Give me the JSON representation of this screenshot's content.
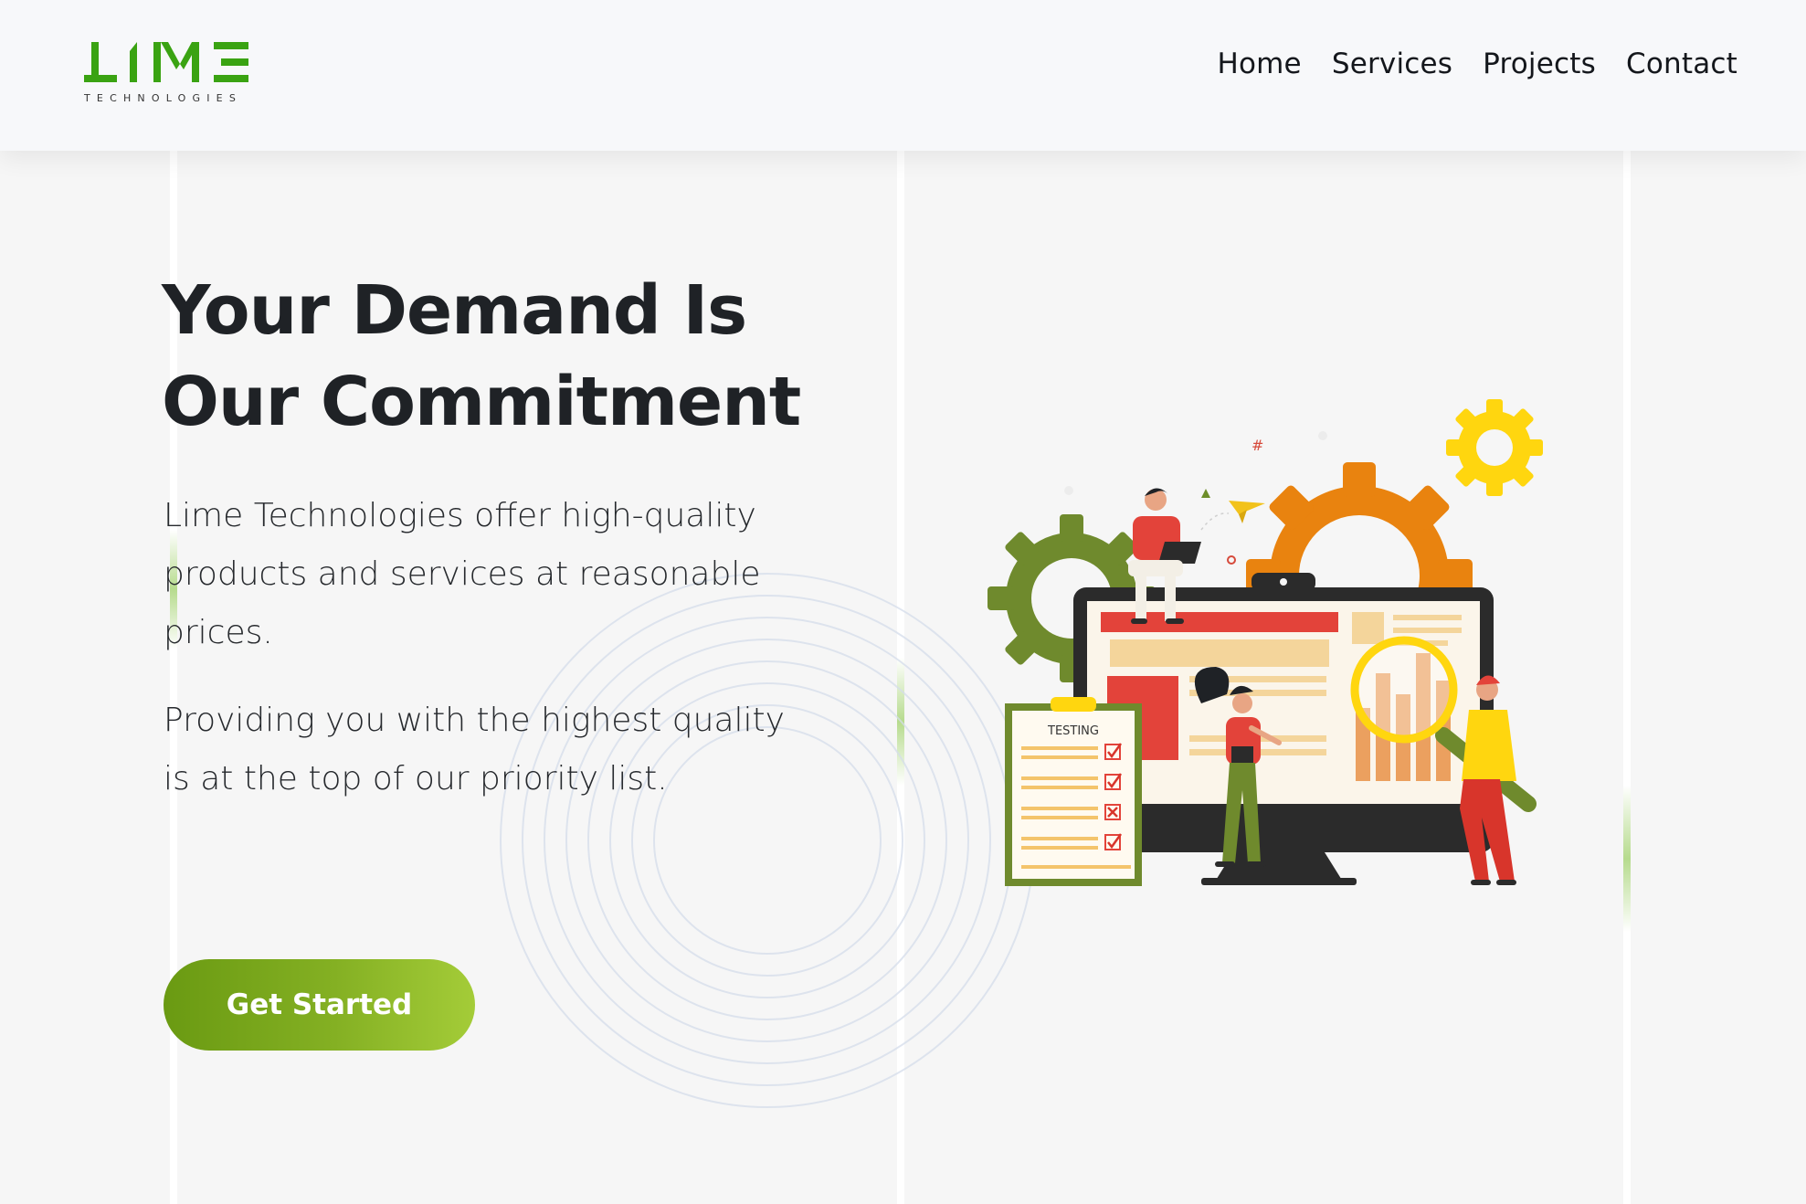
{
  "brand": {
    "name": "LIME",
    "tagline": "TECHNOLOGIES",
    "color": "#3aa312"
  },
  "nav": {
    "items": [
      {
        "label": "Home"
      },
      {
        "label": "Services"
      },
      {
        "label": "Projects"
      },
      {
        "label": "Contact"
      }
    ]
  },
  "hero": {
    "title_line1": "Your Demand Is",
    "title_line2": "Our Commitment",
    "paragraph1": "Lime Technologies offer high-quality products and services at reasonable prices.",
    "paragraph2": "Providing you with the highest quality is at the top of our priority list.",
    "cta_label": "Get Started",
    "cta_gradient": [
      "#6a9a12",
      "#a4cc38"
    ]
  },
  "illustration": {
    "clipboard_label": "TESTING",
    "icons": [
      "gear-icon",
      "magnifier-icon",
      "monitor-icon",
      "clipboard-icon",
      "paper-plane-icon"
    ]
  }
}
